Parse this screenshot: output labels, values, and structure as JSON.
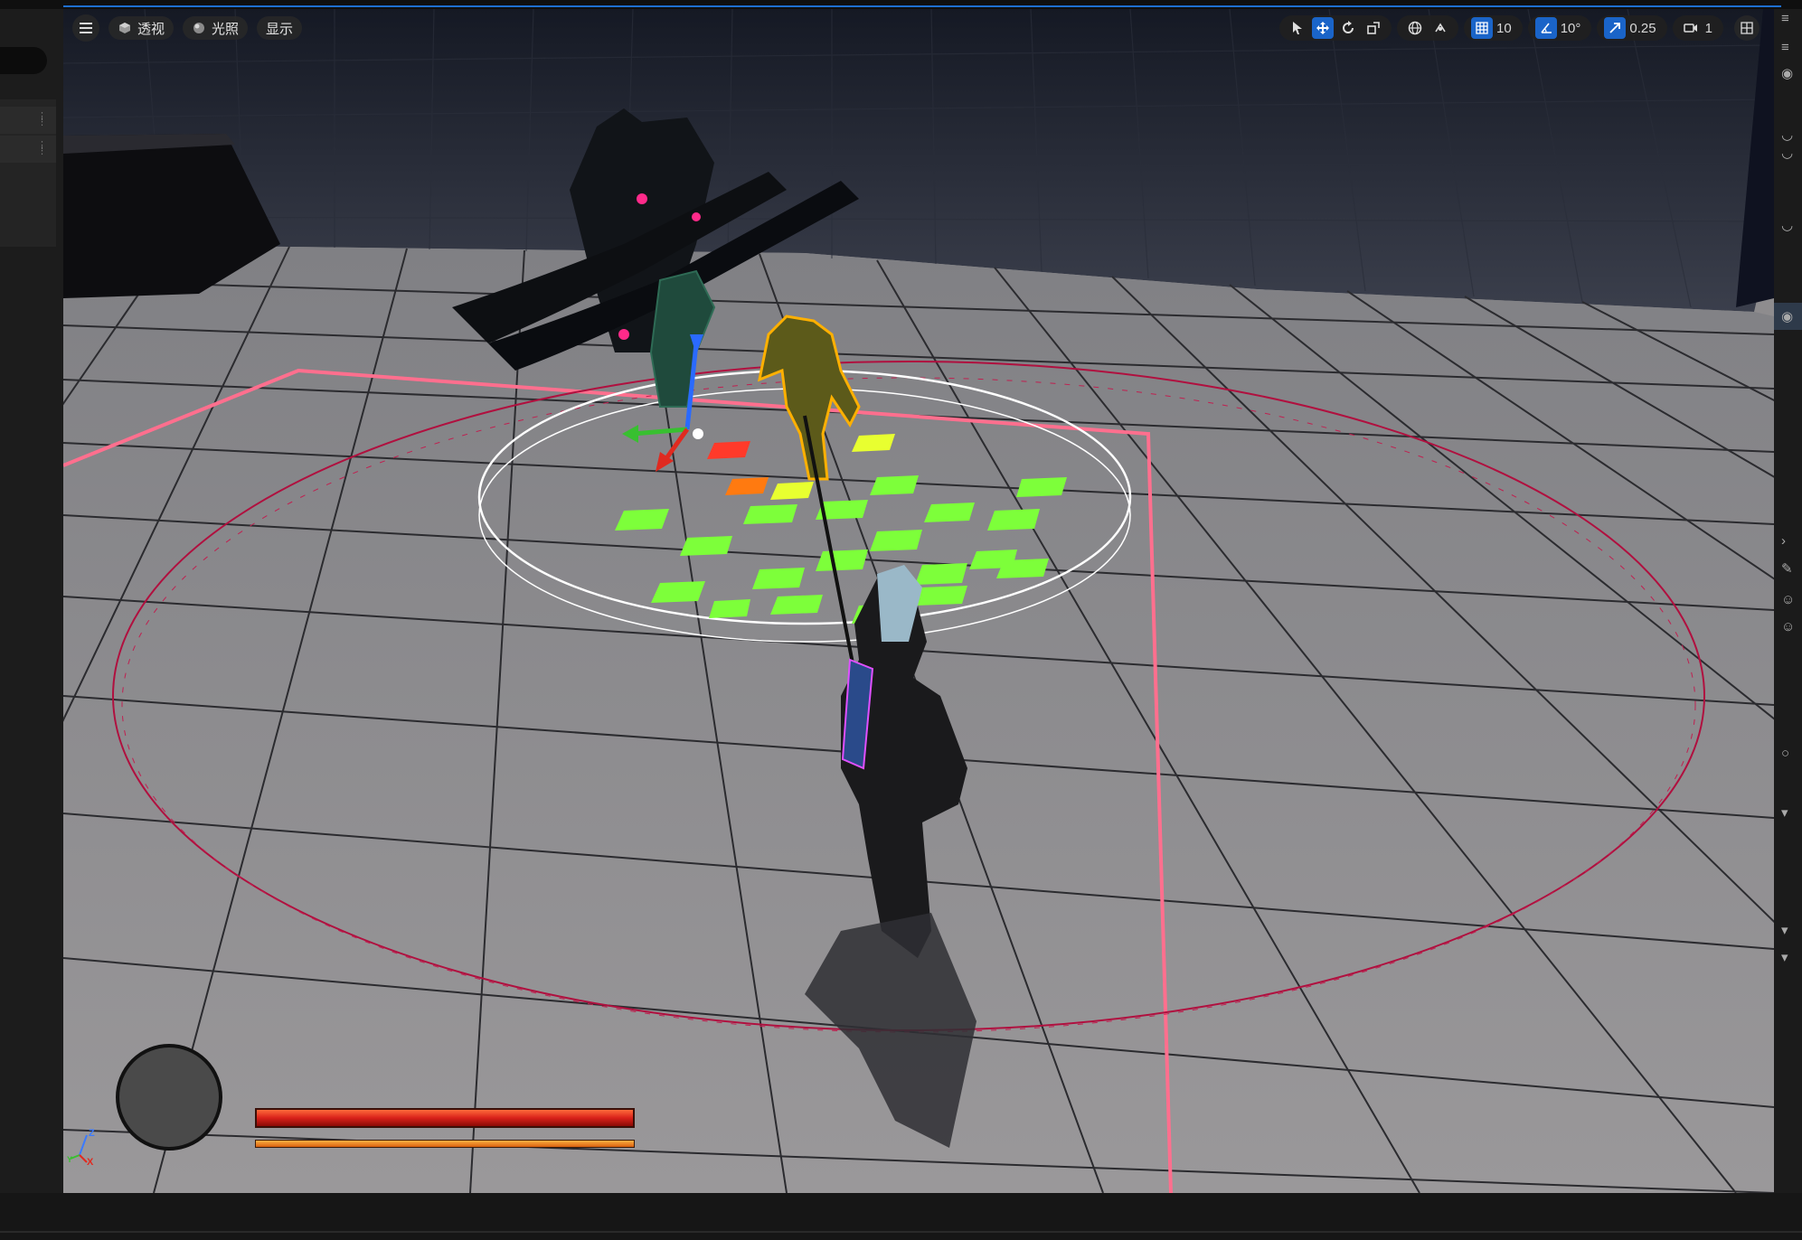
{
  "viewport_toolbar": {
    "menu_icon": "hamburger-menu-icon",
    "view_mode": {
      "icon": "cube-icon",
      "label": "透视"
    },
    "lighting": {
      "icon": "sphere-icon",
      "label": "光照"
    },
    "show": {
      "label": "显示"
    }
  },
  "transform_tools": {
    "select_icon": "cursor-icon",
    "translate_icon": "move-arrows-icon",
    "rotate_icon": "rotate-icon",
    "scale_icon": "scale-icon",
    "world_icon": "globe-icon",
    "surface_snap_icon": "surface-snap-icon",
    "grid_snap": {
      "icon": "grid-icon",
      "value": "10"
    },
    "rotation_snap": {
      "icon": "angle-icon",
      "value": "10°"
    },
    "scale_snap": {
      "icon": "scale-arrow-icon",
      "value": "0.25"
    },
    "camera_speed": {
      "icon": "camera-icon",
      "value": "1"
    },
    "layout_icon": "viewport-layout-icon"
  },
  "hud": {
    "health_fraction": 1.0,
    "stamina_fraction": 1.0
  },
  "axis_gizmo": {
    "x": "X",
    "y": "Y",
    "z": "Z"
  },
  "colors": {
    "accent": "#1a64c8",
    "health": "#d8211a",
    "stamina": "#e07a18",
    "selection_outline": "#ffb000",
    "grid_tile_green": "#7dff3a",
    "boundary_pink": "#ff6a8a"
  }
}
